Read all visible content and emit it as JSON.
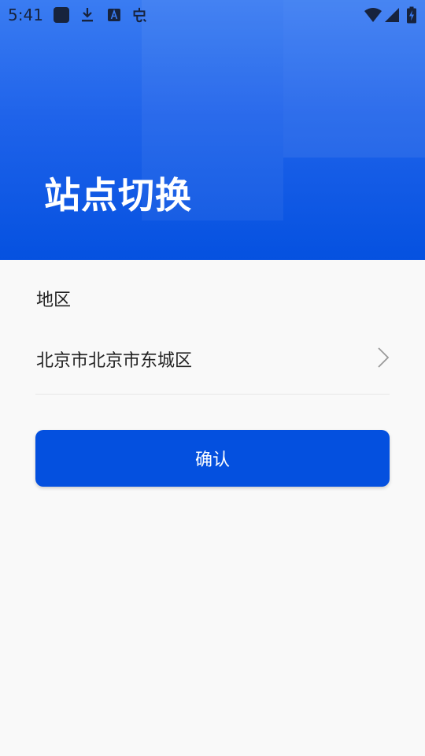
{
  "status_bar": {
    "time": "5:41",
    "icons": [
      "app-square-icon",
      "download-icon",
      "keyboard-a-icon",
      "bug-icon",
      "wifi-icon",
      "cell-signal-icon",
      "battery-charging-icon"
    ]
  },
  "header": {
    "title": "站点切换"
  },
  "form": {
    "region_label": "地区",
    "region_value": "北京市北京市东城区",
    "confirm_label": "确认"
  },
  "colors": {
    "primary": "#0450df",
    "header_top": "#3a7cf2",
    "background": "#f9f9f9"
  }
}
